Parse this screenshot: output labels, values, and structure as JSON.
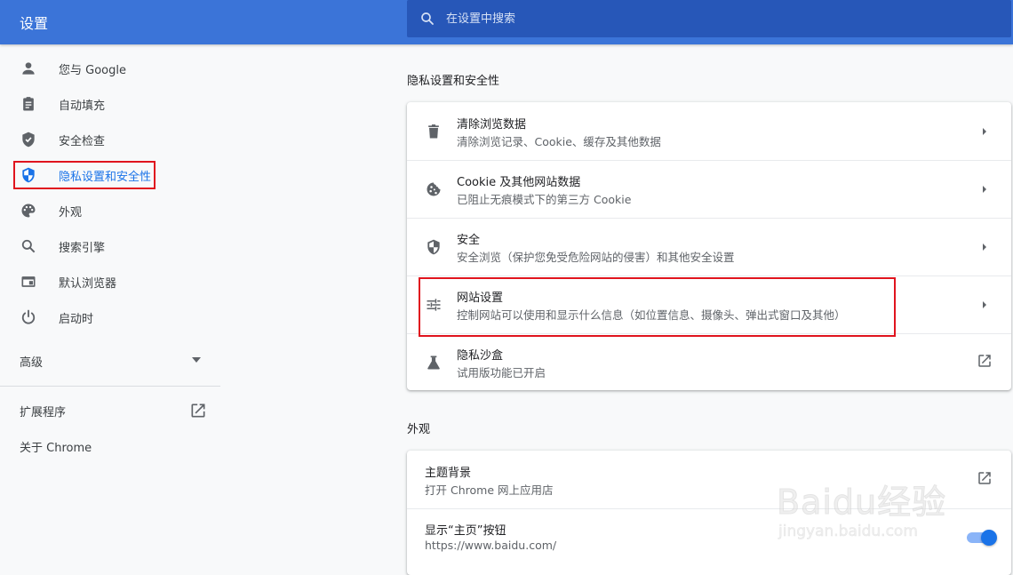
{
  "header": {
    "title": "设置",
    "search_placeholder": "在设置中搜索"
  },
  "sidebar": {
    "items": [
      {
        "label": "您与 Google",
        "icon": "person-icon"
      },
      {
        "label": "自动填充",
        "icon": "clipboard-icon"
      },
      {
        "label": "安全检查",
        "icon": "shield-check-icon"
      },
      {
        "label": "隐私设置和安全性",
        "icon": "shield-privacy-icon",
        "active": true
      },
      {
        "label": "外观",
        "icon": "palette-icon"
      },
      {
        "label": "搜索引擎",
        "icon": "search-icon"
      },
      {
        "label": "默认浏览器",
        "icon": "browser-icon"
      },
      {
        "label": "启动时",
        "icon": "power-icon"
      }
    ],
    "advanced_label": "高级",
    "extensions_label": "扩展程序",
    "about_label": "关于 Chrome"
  },
  "privacy_section": {
    "title": "隐私设置和安全性",
    "rows": [
      {
        "title": "清除浏览数据",
        "subtitle": "清除浏览记录、Cookie、缓存及其他数据",
        "icon": "trash-icon"
      },
      {
        "title": "Cookie 及其他网站数据",
        "subtitle": "已阻止无痕模式下的第三方 Cookie",
        "icon": "cookie-icon"
      },
      {
        "title": "安全",
        "subtitle": "安全浏览（保护您免受危险网站的侵害）和其他安全设置",
        "icon": "security-shield-icon"
      },
      {
        "title": "网站设置",
        "subtitle": "控制网站可以使用和显示什么信息（如位置信息、摄像头、弹出式窗口及其他）",
        "icon": "tune-icon"
      },
      {
        "title": "隐私沙盒",
        "subtitle": "试用版功能已开启",
        "icon": "flask-icon"
      }
    ]
  },
  "appearance_section": {
    "title": "外观",
    "rows": [
      {
        "title": "主题背景",
        "subtitle": "打开 Chrome 网上应用店"
      },
      {
        "title": "显示“主页”按钮",
        "subtitle": "https://www.baidu.com/",
        "toggle_on": true
      }
    ]
  },
  "watermark": {
    "brand": "Baidu经验",
    "url": "jingyan.baidu.com"
  },
  "colors": {
    "header": "#3b74d8",
    "search": "#2757b8",
    "accent": "#1a73e8",
    "highlight": "#e0141e"
  }
}
